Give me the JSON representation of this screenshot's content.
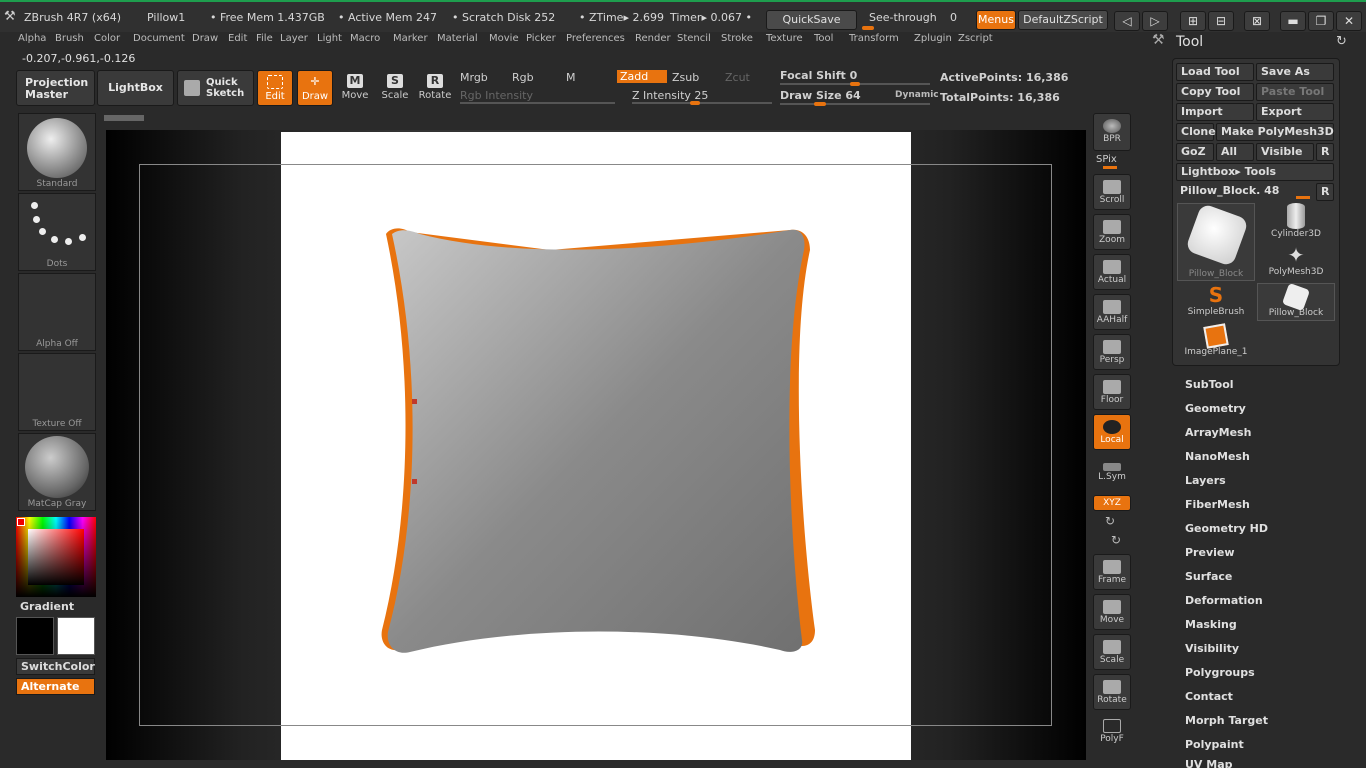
{
  "titlebar": {
    "app": "ZBrush 4R7 (x64)",
    "doc": "Pillow1",
    "free_mem": "• Free Mem 1.437GB",
    "active_mem": "• Active Mem 247",
    "scratch": "• Scratch Disk 252",
    "ztime": "• ZTime▸ 2.699",
    "timer": "Timer▸ 0.067 •",
    "quicksave": "QuickSave",
    "seethrough": "See-through",
    "seethrough_val": "0",
    "menus": "Menus",
    "script": "DefaultZScript"
  },
  "menus": [
    "Alpha",
    "Brush",
    "Color",
    "Document",
    "Draw",
    "Edit",
    "File",
    "Layer",
    "Light",
    "Macro",
    "Marker",
    "Material",
    "Movie",
    "Picker",
    "Preferences",
    "Render",
    "Stencil",
    "Stroke",
    "Texture",
    "Tool",
    "Transform",
    "Zplugin",
    "Zscript"
  ],
  "coords": "-0.207,-0.961,-0.126",
  "shelf": {
    "projection_master": "Projection Master",
    "lightbox": "LightBox",
    "quick_sketch": "Quick Sketch",
    "edit": "Edit",
    "draw": "Draw",
    "move": "Move",
    "scale": "Scale",
    "rotate": "Rotate",
    "mrgb": "Mrgb",
    "rgb": "Rgb",
    "m": "M",
    "zadd": "Zadd",
    "zsub": "Zsub",
    "zcut": "Zcut",
    "rgb_intensity": "Rgb Intensity",
    "z_intensity": "Z Intensity 25",
    "focal_shift": "Focal Shift 0",
    "draw_size": "Draw Size 64",
    "dynamic": "Dynamic",
    "active_points": "ActivePoints: 16,386",
    "total_points": "TotalPoints: 16,386"
  },
  "left": {
    "brush": "Standard",
    "stroke": "Dots",
    "alpha": "Alpha Off",
    "texture": "Texture Off",
    "material": "MatCap Gray",
    "gradient": "Gradient",
    "switchcolor": "SwitchColor",
    "alternate": "Alternate"
  },
  "righttools": [
    {
      "name": "bpr",
      "label": "BPR"
    },
    {
      "name": "spix",
      "label": "SPix"
    },
    {
      "name": "scroll",
      "label": "Scroll"
    },
    {
      "name": "zoom",
      "label": "Zoom"
    },
    {
      "name": "actual",
      "label": "Actual"
    },
    {
      "name": "aahalf",
      "label": "AAHalf"
    },
    {
      "name": "persp",
      "label": "Persp"
    },
    {
      "name": "floor",
      "label": "Floor"
    },
    {
      "name": "local",
      "label": "Local"
    },
    {
      "name": "lsym",
      "label": "L.Sym"
    },
    {
      "name": "xyz",
      "label": "XYZ"
    },
    {
      "name": "frame",
      "label": "Frame"
    },
    {
      "name": "move",
      "label": "Move"
    },
    {
      "name": "scale",
      "label": "Scale"
    },
    {
      "name": "rotate",
      "label": "Rotate"
    },
    {
      "name": "polyf",
      "label": "PolyF"
    }
  ],
  "tool": {
    "title": "Tool",
    "load": "Load Tool",
    "save_as": "Save As",
    "copy": "Copy Tool",
    "paste": "Paste Tool",
    "import": "Import",
    "export": "Export",
    "clone": "Clone",
    "make_polymesh": "Make PolyMesh3D",
    "goz": "GoZ",
    "all": "All",
    "visible": "Visible",
    "r": "R",
    "lightbox_tools": "Lightbox▸ Tools",
    "current": "Pillow_Block. 48",
    "thumbs": [
      "Pillow_Block",
      "Cylinder3D",
      "PolyMesh3D",
      "SimpleBrush",
      "Pillow_Block",
      "ImagePlane_1"
    ],
    "sections": [
      "SubTool",
      "Geometry",
      "ArrayMesh",
      "NanoMesh",
      "Layers",
      "FiberMesh",
      "Geometry HD",
      "Preview",
      "Surface",
      "Deformation",
      "Masking",
      "Visibility",
      "Polygroups",
      "Contact",
      "Morph Target",
      "Polypaint",
      "UV Map"
    ]
  },
  "colors": {
    "accent": "#e8730f",
    "bg": "#2a2a2a"
  }
}
